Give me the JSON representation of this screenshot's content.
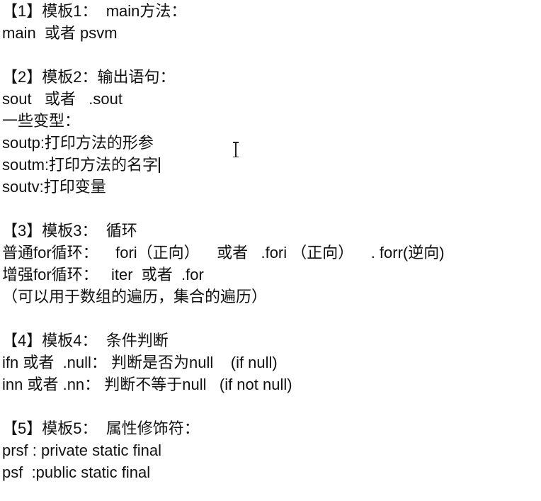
{
  "lines": [
    "【1】模板1：  main方法：",
    "main  或者 psvm",
    "",
    "【2】模板2：输出语句：",
    "sout   或者   .sout",
    "一些变型：",
    "soutp:打印方法的形参",
    "soutm:打印方法的名字",
    "soutv:打印变量",
    "",
    "【3】模板3：  循环",
    "普通for循环：    fori（正向）    或者   .fori （正向）    . forr(逆向)",
    "增强for循环：   iter  或者  .for",
    "（可以用于数组的遍历，集合的遍历）",
    "",
    "【4】模板4：  条件判断",
    "ifn 或者  .null： 判断是否为null    (if null)",
    "inn 或者 .nn： 判断不等于null   (if not null)",
    "",
    "【5】模板5：  属性修饰符：",
    "prsf : private static final",
    "psf  :public static final"
  ],
  "cursor_icon": "i-beam-cursor-icon",
  "caret_after_line": 7
}
